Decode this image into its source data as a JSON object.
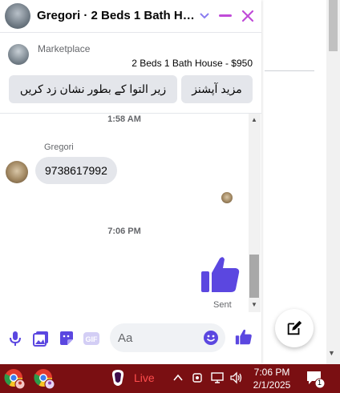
{
  "header": {
    "title": "Gregori · 2 Beds 1 Bath Ho..."
  },
  "marketplace": {
    "label": "Marketplace",
    "item": "2 Beds 1 Bath House - $950",
    "more_options": "مزید آپشنز",
    "mark_sold": "زیر التوا کے بطور نشان زد کریں"
  },
  "messages": {
    "time1": "1:58 AM",
    "sender": "Gregori",
    "bubble": "9738617992",
    "time2": "7:06 PM",
    "status": "Sent"
  },
  "composer": {
    "placeholder": "Aa"
  },
  "taskbar": {
    "live": "Live",
    "time": "7:06 PM",
    "date": "2/1/2025",
    "notifications": "1"
  },
  "colors": {
    "accent": "#5b47e0",
    "taskbar": "#7a0f12"
  }
}
